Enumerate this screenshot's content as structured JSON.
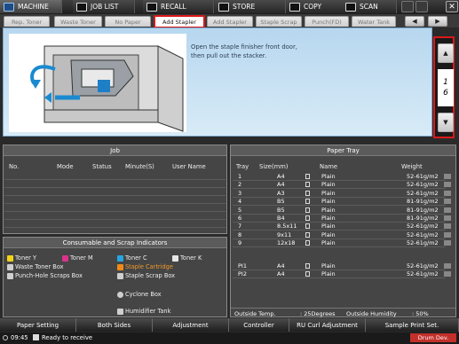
{
  "topbar": {
    "tabs": [
      {
        "label": "MACHINE",
        "icon": "machine-icon"
      },
      {
        "label": "JOB LIST",
        "icon": "job-list-icon"
      },
      {
        "label": "RECALL",
        "icon": "recall-icon"
      },
      {
        "label": "STORE",
        "icon": "store-icon"
      },
      {
        "label": "COPY",
        "icon": "copy-icon"
      },
      {
        "label": "SCAN",
        "icon": "scan-icon"
      }
    ],
    "close": "✕"
  },
  "message_tabs": [
    "Rep. Toner",
    "Waste Toner",
    "No Paper",
    "Add Stapler",
    "Add Stapler",
    "Staple Scrap",
    "Punch(FD)",
    "Water Tank"
  ],
  "message_tabs_active": "Add Stapler",
  "nav": {
    "prev": "◀",
    "next": "▶"
  },
  "message": {
    "line1": "Open the staple finisher front door,",
    "line2": "then pull out the stacker."
  },
  "pager": {
    "up": "▲",
    "down": "▼",
    "current": "1",
    "total": "6"
  },
  "job": {
    "title": "Job",
    "columns": [
      "No.",
      "Mode",
      "Status",
      "Minute(S)",
      "User Name"
    ],
    "rows": [
      [],
      [],
      [],
      [],
      [],
      [],
      [],
      []
    ]
  },
  "consumables": {
    "title": "Consumable and Scrap Indicators",
    "items": [
      {
        "label": "Toner Y",
        "color": "#f2d21b"
      },
      {
        "label": "Toner M",
        "color": "#d9338b"
      },
      {
        "label": "Toner C",
        "color": "#27a6e0"
      },
      {
        "label": "Toner K",
        "color": "#e6e6e6"
      },
      {
        "label": "Waste Toner Box",
        "color": "#cfcfcf"
      },
      {
        "label": "Staple Cartridge",
        "color": "#f08a18"
      },
      {
        "label": "Punch-Hole Scraps Box",
        "color": "#cfcfcf"
      },
      {
        "label": "Staple Scrap Box",
        "color": "#cfcfcf"
      },
      {
        "label": "Cyclone Box",
        "color": "#cfcfcf"
      },
      {
        "label": "Humidifier Tank",
        "color": "#cfcfcf"
      }
    ]
  },
  "paper_tray": {
    "title": "Paper Tray",
    "columns": [
      "Tray",
      "Size(mm)",
      "Name",
      "Weight"
    ],
    "rows": [
      [
        "1",
        "A4",
        "Plain",
        "52-61g/m2"
      ],
      [
        "2",
        "A4",
        "Plain",
        "52-61g/m2"
      ],
      [
        "3",
        "A3",
        "Plain",
        "52-61g/m2"
      ],
      [
        "4",
        "B5",
        "Plain",
        "81-91g/m2"
      ],
      [
        "5",
        "B5",
        "Plain",
        "81-91g/m2"
      ],
      [
        "6",
        "B4",
        "Plain",
        "81-91g/m2"
      ],
      [
        "7",
        "8.5x11",
        "Plain",
        "52-61g/m2"
      ],
      [
        "8",
        "9x11",
        "Plain",
        "52-61g/m2"
      ],
      [
        "9",
        "12x18",
        "Plain",
        "52-61g/m2"
      ]
    ],
    "pi_rows": [
      [
        "PI1",
        "A4",
        "Plain",
        "52-61g/m2"
      ],
      [
        "PI2",
        "A4",
        "Plain",
        "52-61g/m2"
      ]
    ],
    "outside_temp_label": "Outside Temp.",
    "outside_temp": ": 25Degrees",
    "outside_humidity_label": "Outside Humidity",
    "outside_humidity": ": 50%"
  },
  "bottom_buttons": [
    "Paper Setting",
    "Both Sides",
    "Adjustment",
    "Controller",
    "RU Curl Adjustment",
    "Sample Print Set."
  ],
  "status": {
    "time": "09:45",
    "text": "Ready to receive",
    "badge": "Drum Dev."
  },
  "colors": {
    "accent_red": "#d81a1a",
    "panel_blue": "#b7d7ef",
    "header_dark": "#2a2a2a"
  }
}
